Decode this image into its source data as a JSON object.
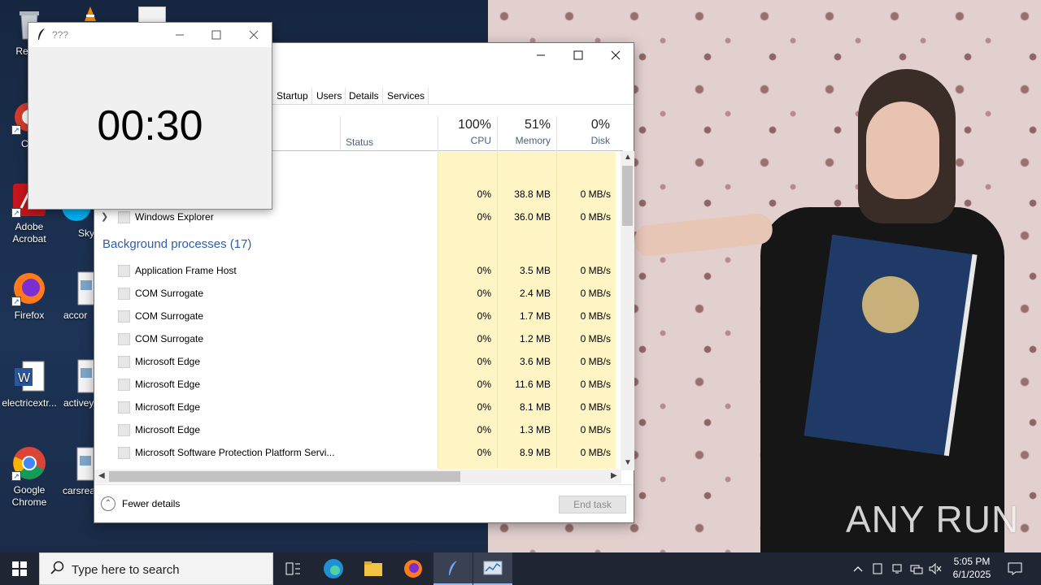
{
  "desktop": {
    "icons": [
      {
        "label": "Recyc",
        "icon": "recycle-bin-icon"
      },
      {
        "label": "CCl",
        "icon": "ccleaner-icon"
      },
      {
        "label": "Adobe Acrobat",
        "icon": "acrobat-icon"
      },
      {
        "label": "Sky",
        "icon": "skype-icon"
      },
      {
        "label": "Firefox",
        "icon": "firefox-icon"
      },
      {
        "label": "accor",
        "icon": "image-file-icon"
      },
      {
        "label": "electricextr...",
        "icon": "word-doc-icon"
      },
      {
        "label": "activey",
        "icon": "image-file-icon"
      },
      {
        "label": "Google Chrome",
        "icon": "chrome-icon"
      },
      {
        "label": "carsrea",
        "icon": "image-file-icon"
      }
    ]
  },
  "timer_window": {
    "title": "???",
    "time": "00:30"
  },
  "task_manager": {
    "tabs": [
      "Startup",
      "Users",
      "Details",
      "Services"
    ],
    "columns": {
      "status": "Status",
      "cpu": {
        "pct": "100%",
        "name": "CPU"
      },
      "memory": {
        "pct": "51%",
        "name": "Memory"
      },
      "disk": {
        "pct": "0%",
        "name": "Disk"
      }
    },
    "app_rows": [
      {
        "name": "",
        "cpu": "0%",
        "memory": "38.8 MB",
        "disk": "0 MB/s"
      },
      {
        "name": "Windows Explorer",
        "cpu": "0%",
        "memory": "36.0 MB",
        "disk": "0 MB/s"
      }
    ],
    "group_title": "Background processes (17)",
    "bg_rows": [
      {
        "name": "Application Frame Host",
        "cpu": "0%",
        "memory": "3.5 MB",
        "disk": "0 MB/s"
      },
      {
        "name": "COM Surrogate",
        "cpu": "0%",
        "memory": "2.4 MB",
        "disk": "0 MB/s"
      },
      {
        "name": "COM Surrogate",
        "cpu": "0%",
        "memory": "1.7 MB",
        "disk": "0 MB/s"
      },
      {
        "name": "COM Surrogate",
        "cpu": "0%",
        "memory": "1.2 MB",
        "disk": "0 MB/s"
      },
      {
        "name": "Microsoft Edge",
        "cpu": "0%",
        "memory": "3.6 MB",
        "disk": "0 MB/s"
      },
      {
        "name": "Microsoft Edge",
        "cpu": "0%",
        "memory": "11.6 MB",
        "disk": "0 MB/s"
      },
      {
        "name": "Microsoft Edge",
        "cpu": "0%",
        "memory": "8.1 MB",
        "disk": "0 MB/s"
      },
      {
        "name": "Microsoft Edge",
        "cpu": "0%",
        "memory": "1.3 MB",
        "disk": "0 MB/s"
      },
      {
        "name": "Microsoft Software Protection Platform Servi...",
        "cpu": "0%",
        "memory": "8.9 MB",
        "disk": "0 MB/s"
      }
    ],
    "fewer_details": "Fewer details",
    "end_task": "End task"
  },
  "taskbar": {
    "search_placeholder": "Type here to search",
    "time": "5:05 PM",
    "date": "6/1/2025",
    "pinned": [
      "task-view-icon",
      "edge-icon",
      "file-explorer-icon",
      "firefox-icon",
      "feather-app-icon",
      "task-manager-icon"
    ]
  },
  "watermark": "ANY RUN",
  "colors": {
    "accent_blue": "#2e5ea8",
    "heat_yellow": "#fff4c4",
    "taskbar": "#1f2533"
  }
}
